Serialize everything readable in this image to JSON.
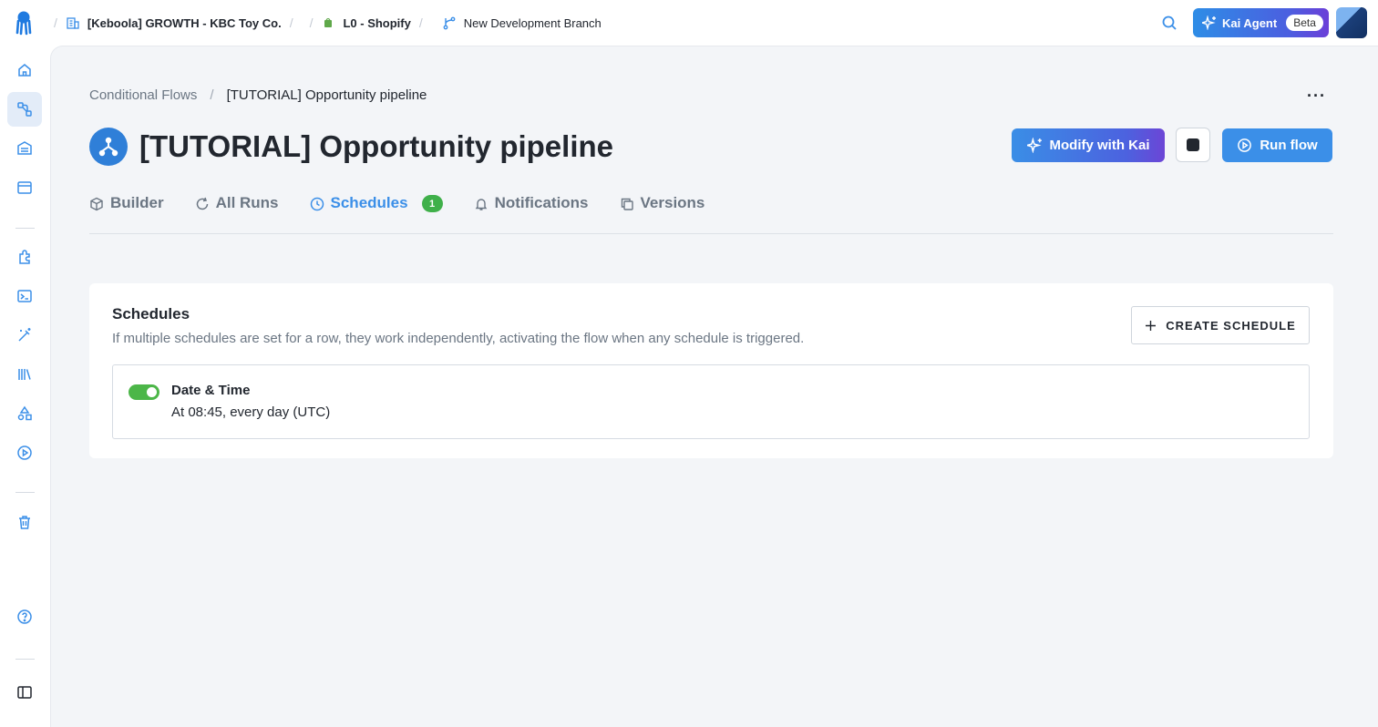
{
  "topbar": {
    "breadcrumbs": [
      {
        "label": "[Keboola] GROWTH - KBC Toy Co.",
        "icon": "building-icon"
      },
      {
        "label": "",
        "icon": ""
      },
      {
        "label": "L0 - Shopify",
        "icon": "shopify-icon"
      },
      {
        "label": "New Development Branch",
        "icon": "branch-icon"
      }
    ],
    "kai_agent_label": "Kai Agent",
    "kai_agent_badge": "Beta"
  },
  "sidebar": {
    "items": [
      {
        "icon": "home-icon",
        "active": false
      },
      {
        "icon": "flows-icon",
        "active": true
      },
      {
        "icon": "storage-icon",
        "active": false
      },
      {
        "icon": "workspace-icon",
        "active": false
      },
      {
        "icon": "components-icon",
        "active": false
      },
      {
        "icon": "terminal-icon",
        "active": false
      },
      {
        "icon": "magic-wand-icon",
        "active": false
      },
      {
        "icon": "library-icon",
        "active": false
      },
      {
        "icon": "shapes-icon",
        "active": false
      },
      {
        "icon": "play-circle-icon",
        "active": false
      },
      {
        "icon": "trash-icon",
        "active": false
      },
      {
        "icon": "help-icon",
        "active": false
      },
      {
        "icon": "sidebar-toggle-icon",
        "active": false
      }
    ]
  },
  "page": {
    "breadcrumb_parent": "Conditional Flows",
    "breadcrumb_sep": "/",
    "breadcrumb_current": "[TUTORIAL] Opportunity pipeline",
    "more_label": "···",
    "title": "[TUTORIAL] Opportunity pipeline",
    "modify_label": "Modify with Kai",
    "run_label": "Run flow",
    "colors": {
      "accent": "#3b8fe8",
      "success": "#4cb648"
    }
  },
  "tabs": [
    {
      "label": "Builder",
      "icon": "cube-icon",
      "active": false
    },
    {
      "label": "All Runs",
      "icon": "refresh-icon",
      "active": false
    },
    {
      "label": "Schedules",
      "icon": "clock-icon",
      "active": true,
      "badge": "1"
    },
    {
      "label": "Notifications",
      "icon": "bell-icon",
      "active": false
    },
    {
      "label": "Versions",
      "icon": "copy-icon",
      "active": false
    }
  ],
  "schedules": {
    "title": "Schedules",
    "description": "If multiple schedules are set for a row, they work independently, activating the flow when any schedule is triggered.",
    "create_label": "CREATE SCHEDULE",
    "items": [
      {
        "name": "Date & Time",
        "description": "At 08:45, every day (UTC)",
        "enabled": true
      }
    ]
  }
}
